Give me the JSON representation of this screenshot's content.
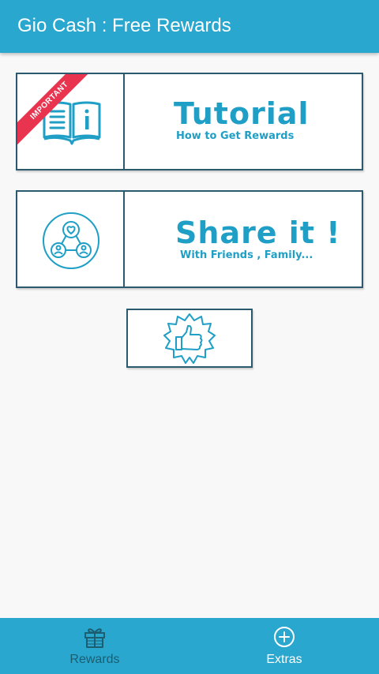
{
  "app_bar": {
    "title": "Gio Cash : Free Rewards"
  },
  "cards": {
    "tutorial": {
      "badge": "IMPORTANT",
      "icon": "book-icon",
      "title": "Tutorial",
      "subtitle": "How to Get Rewards"
    },
    "share": {
      "icon": "share-friends-icon",
      "title": "Share it !",
      "subtitle": "With Friends , Family..."
    },
    "rate": {
      "icon": "thumbs-up-badge-icon"
    }
  },
  "bottom_nav": {
    "items": [
      {
        "label": "Rewards",
        "icon": "gift-icon",
        "active": false
      },
      {
        "label": "Extras",
        "icon": "add-circle-icon",
        "active": true
      }
    ]
  },
  "colors": {
    "primary": "#29a7cf",
    "accent_text": "#1f9fc6",
    "card_border": "#2b5a6e",
    "ribbon": "#e8344e",
    "inactive_nav": "#1d5d70"
  }
}
